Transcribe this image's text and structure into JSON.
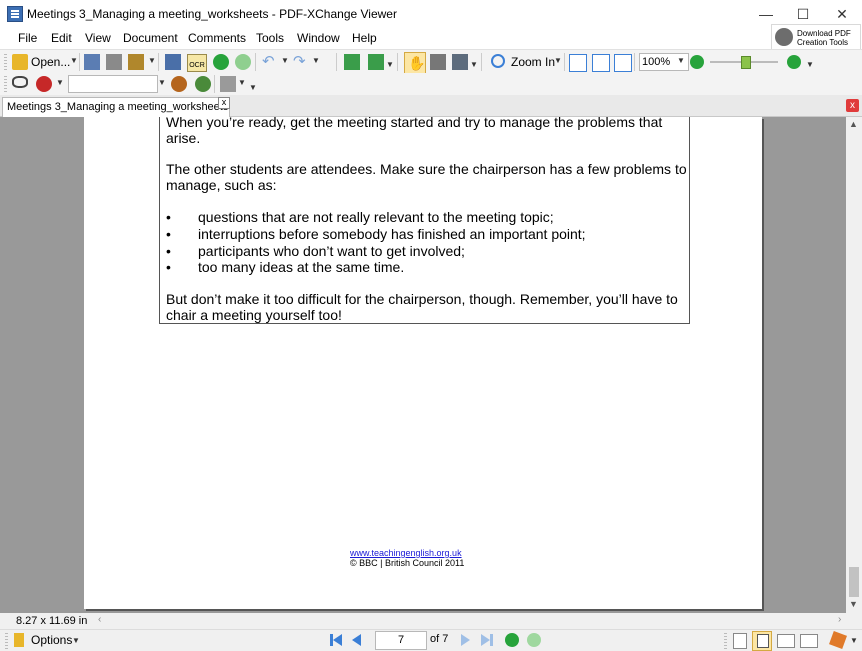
{
  "window": {
    "title": "Meetings 3_Managing a meeting_worksheets - PDF-XChange Viewer",
    "minimize": "—",
    "maximize": "☐",
    "close": "✕"
  },
  "menu": {
    "items": [
      "File",
      "Edit",
      "View",
      "Document",
      "Comments",
      "Tools",
      "Window",
      "Help"
    ],
    "download_line1": "Download PDF",
    "download_line2": "Creation Tools"
  },
  "toolbar": {
    "open_label": "Open...",
    "ocr_label": "OCR",
    "zoom_in_label": "Zoom In",
    "zoom_value": "100%",
    "search_value": ""
  },
  "tabs": {
    "doc_tab_label": "Meetings 3_Managing a meeting_worksheets",
    "tab_close": "x",
    "close_all": "x"
  },
  "document": {
    "para1_line1": "When you’re ready, get the meeting started and try to manage the problems that",
    "para1_line2": "arise.",
    "para2_line1": "The other students are attendees. Make sure the chairperson has a few problems to",
    "para2_line2": "manage, such as:",
    "bullets": [
      "questions that are not really relevant to the meeting topic;",
      "interruptions before somebody has finished an important point;",
      "participants who don’t want to get involved;",
      "too many ideas at the same time."
    ],
    "para3_line1": "But don’t make it too difficult for the chairperson, though. Remember, you’ll have to",
    "para3_line2": "chair a meeting yourself too!",
    "footer_link": "www.teachingenglish.org.uk",
    "footer_copy": "© BBC | British Council 2011"
  },
  "status": {
    "page_size": "8.27 x 11.69 in",
    "options_label": "Options",
    "current_page": "7",
    "page_of": "of 7"
  },
  "colors": {
    "viewport_bg": "#999999",
    "accent_blue": "#3b7fd6",
    "nav_green": "#2ea043"
  }
}
